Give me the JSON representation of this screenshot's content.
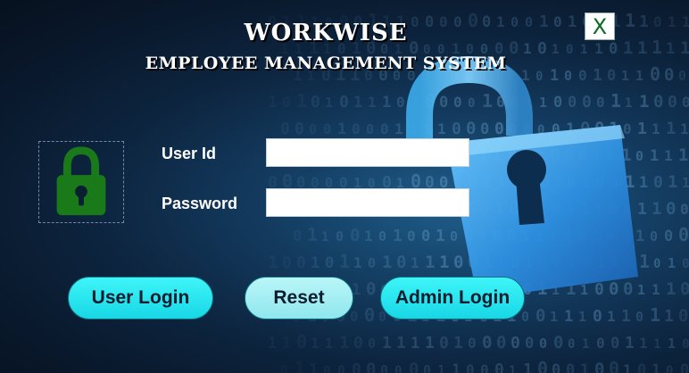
{
  "header": {
    "title": "WORKWISE",
    "subtitle": "EMPLOYEE MANAGEMENT SYSTEM"
  },
  "close_button": {
    "label": "X",
    "icon": "excel-close-icon",
    "color": "#0a6b25"
  },
  "form": {
    "user_id_label": "User Id",
    "user_id_value": "",
    "password_label": "Password",
    "password_value": ""
  },
  "buttons": {
    "user_login": "User Login",
    "reset": "Reset",
    "admin_login": "Admin Login"
  },
  "colors": {
    "background": "#0d2540",
    "button_accent": "#29e6f0",
    "lock_icon": "#1a7a1a"
  },
  "icons": {
    "login_lock": "padlock-icon",
    "background_lock": "open-padlock-icon"
  }
}
